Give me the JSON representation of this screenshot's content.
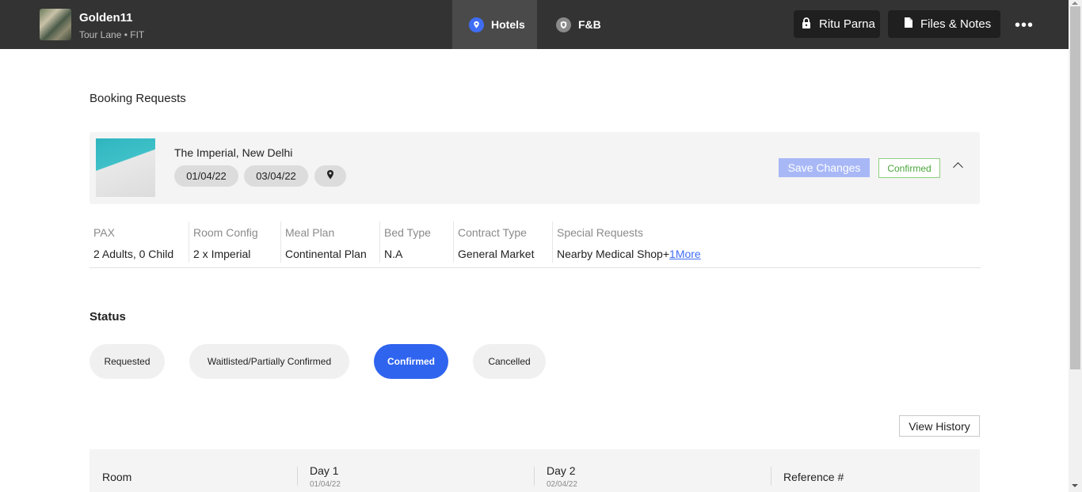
{
  "header": {
    "trip_name": "Golden11",
    "trip_subtitle": "Tour Lane • FIT",
    "tabs": [
      {
        "label": "Hotels",
        "icon": "location-pin-icon",
        "active": true
      },
      {
        "label": "F&B",
        "icon": "shield-icon",
        "active": false
      }
    ],
    "user_button": "Ritu Parna",
    "files_button": "Files & Notes",
    "more_menu": "•••"
  },
  "booking": {
    "section_title": "Booking Requests",
    "hotel_name": "The Imperial, New Delhi",
    "check_in": "01/04/22",
    "check_out": "03/04/22",
    "save_label": "Save Changes",
    "status_badge": "Confirmed",
    "details": {
      "pax": {
        "label": "PAX",
        "value": "2 Adults, 0 Child"
      },
      "room_config": {
        "label": "Room Config",
        "value": "2 x Imperial"
      },
      "meal_plan": {
        "label": "Meal Plan",
        "value": "Continental Plan"
      },
      "bed_type": {
        "label": "Bed Type",
        "value": "N.A"
      },
      "contract_type": {
        "label": "Contract Type",
        "value": "General Market"
      },
      "special_requests": {
        "label": "Special Requests",
        "value": "Nearby Medical Shop+",
        "more_link": "1More"
      }
    }
  },
  "status": {
    "title": "Status",
    "options": [
      "Requested",
      "Waitlisted/Partially Confirmed",
      "Confirmed",
      "Cancelled"
    ],
    "selected": "Confirmed"
  },
  "history_button": "View History",
  "room_table": {
    "columns": {
      "room": "Room",
      "day1": {
        "label": "Day 1",
        "date": "01/04/22"
      },
      "day2": {
        "label": "Day 2",
        "date": "02/04/22"
      },
      "reference": "Reference #"
    }
  },
  "colors": {
    "topbar": "#333333",
    "accent": "#2f64ef",
    "confirmed_green": "#4aa63a",
    "save_disabled": "#a8b8f7"
  }
}
